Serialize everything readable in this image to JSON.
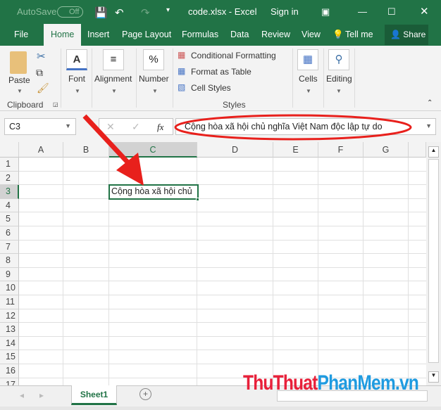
{
  "titlebar": {
    "autosave": "AutoSave",
    "autosave_state": "Off",
    "title": "code.xlsx  -  Excel",
    "sign_in": "Sign in"
  },
  "tabs": [
    "File",
    "Home",
    "Insert",
    "Page Layout",
    "Formulas",
    "Data",
    "Review",
    "View"
  ],
  "tell_me": "Tell me",
  "share": "Share",
  "ribbon": {
    "paste": "Paste",
    "clipboard": "Clipboard",
    "font": "Font",
    "alignment": "Alignment",
    "number": "Number",
    "conditional_formatting": "Conditional Formatting",
    "format_as_table": "Format as Table",
    "cell_styles": "Cell Styles",
    "styles": "Styles",
    "cells": "Cells",
    "editing": "Editing"
  },
  "formula_bar": {
    "name_box": "C3",
    "fx": "fx",
    "value": "Cộng hòa xã hội chủ nghĩa Việt Nam độc lập tự do"
  },
  "columns": [
    "A",
    "B",
    "C",
    "D",
    "E",
    "F",
    "G"
  ],
  "rows": [
    "1",
    "2",
    "3",
    "4",
    "5",
    "6",
    "7",
    "8",
    "9",
    "10",
    "11",
    "12",
    "13",
    "14",
    "15",
    "16",
    "17"
  ],
  "cell_c3": "Cộng hòa xã hội chủ",
  "sheet_tab": "Sheet1",
  "watermark": {
    "part1": "ThuThuat",
    "part2": "PhanMem.vn"
  },
  "colors": {
    "excel_green": "#217346",
    "annotation_red": "#e8201c"
  }
}
